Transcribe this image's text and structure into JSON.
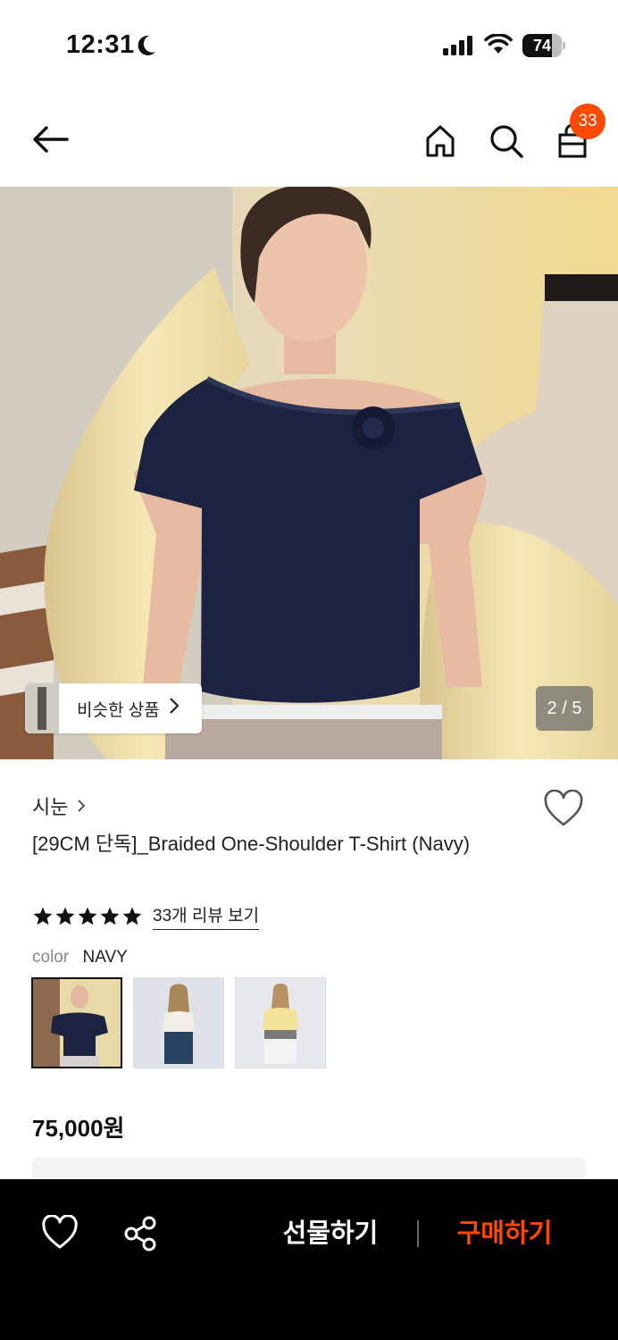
{
  "status_bar": {
    "time": "12:31",
    "battery": "74",
    "battery_level": 0.74
  },
  "nav": {
    "cart_count": "33"
  },
  "gallery": {
    "similar_label": "비슷한 상품",
    "page_indicator": "2 / 5"
  },
  "product": {
    "brand": "시눈",
    "title": "[29CM 단독]_Braided One-Shoulder T-Shirt (Navy)",
    "rating_stars": 5,
    "review_link": "33개 리뷰 보기",
    "color_label": "color",
    "color_value": "NAVY",
    "price": "75,000원"
  },
  "bottom_bar": {
    "gift_label": "선물하기",
    "buy_label": "구매하기"
  },
  "colors": {
    "accent": "#ff4800",
    "navy_shirt": "#1b2340"
  }
}
